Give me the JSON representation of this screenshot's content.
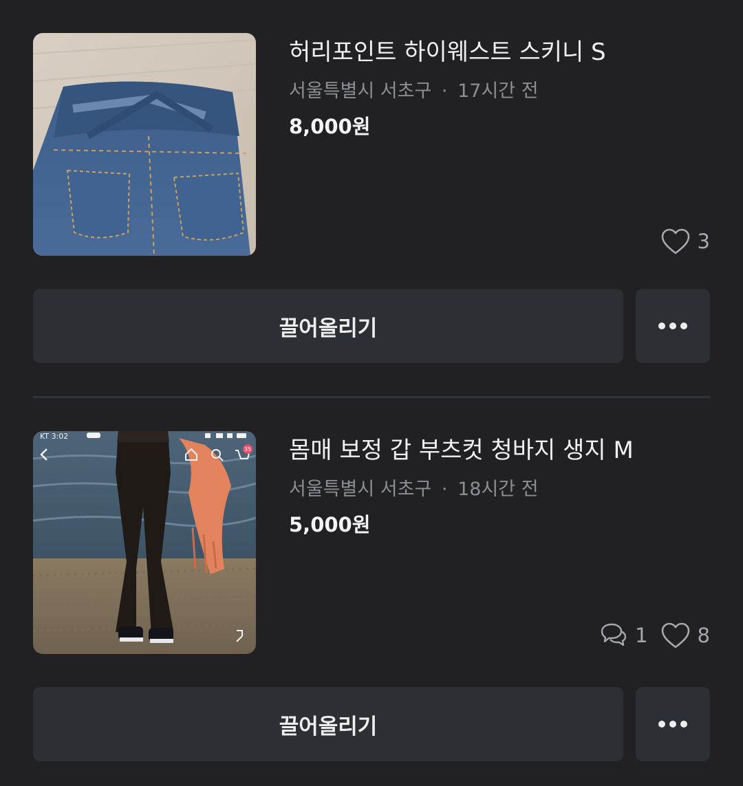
{
  "items": [
    {
      "title": "허리포인트 하이웨스트 스키니 S",
      "location": "서울특별시 서초구",
      "separator": "·",
      "time": "17시간 전",
      "price": "8,000원",
      "likes": "3",
      "bump_label": "끌어올리기",
      "photo": "denim-jeans-back-photo"
    },
    {
      "title": "몸매 보정 갑 부츠컷 청바지 생지 M",
      "location": "서울특별시 서초구",
      "separator": "·",
      "time": "18시간 전",
      "price": "5,000원",
      "chats": "1",
      "likes": "8",
      "bump_label": "끌어올리기",
      "photo": "bootcut-jeans-beach-photo",
      "photo_overlay": {
        "status_time": "KT 3:02",
        "cart_badge": "35"
      }
    }
  ],
  "icons": {
    "heart": "heart-outline-icon",
    "chat": "chat-bubble-icon",
    "more": "more-horizontal-icon"
  },
  "colors": {
    "background": "#212124",
    "button": "#2c2f33",
    "meta_text": "#8b8e95",
    "count_text": "#a5a8ae"
  }
}
